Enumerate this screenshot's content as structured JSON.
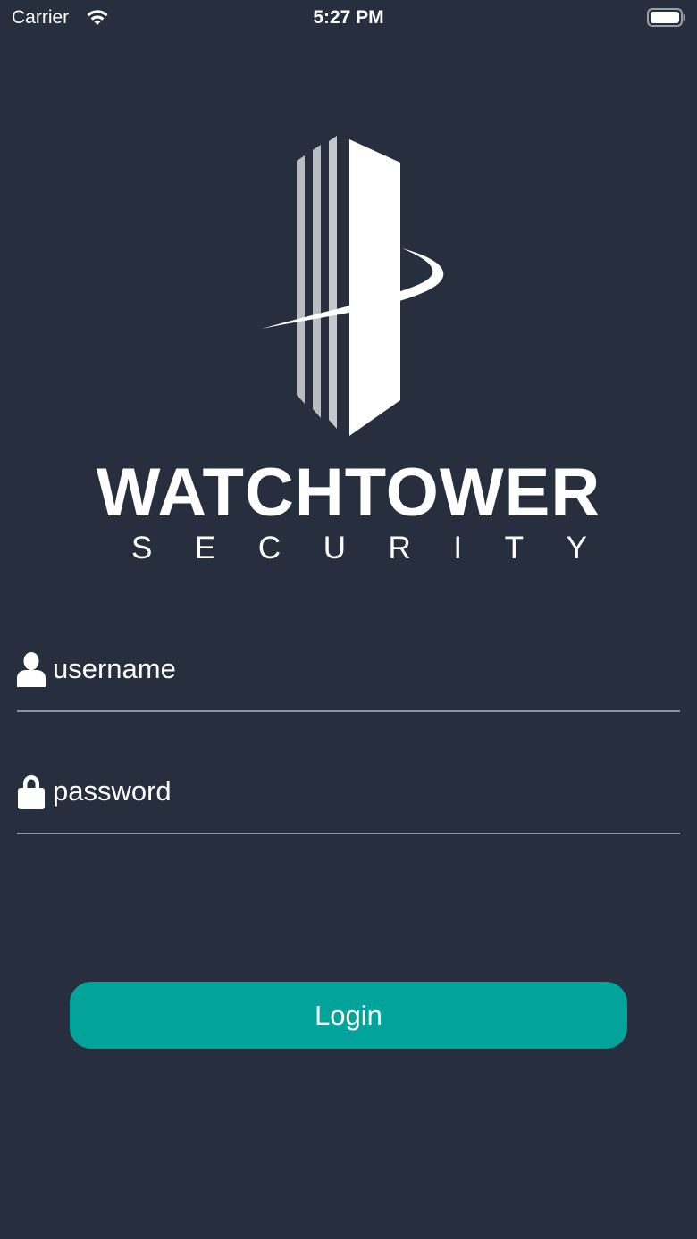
{
  "status_bar": {
    "carrier": "Carrier",
    "time": "5:27 PM",
    "wifi_icon": "wifi-icon",
    "battery_icon": "battery-icon"
  },
  "brand": {
    "logo_icon": "watchtower-logo-icon",
    "name": "WATCHTOWER",
    "subtitle_letters": [
      "S",
      "E",
      "C",
      "U",
      "R",
      "I",
      "T",
      "Y"
    ]
  },
  "login_form": {
    "username": {
      "icon": "user-icon",
      "placeholder": "username",
      "value": ""
    },
    "password": {
      "icon": "lock-icon",
      "placeholder": "password",
      "value": ""
    },
    "login_label": "Login"
  },
  "colors": {
    "background": "#272f3e",
    "accent": "#02a39a",
    "text": "#ffffff",
    "divider": "#8d95a2"
  }
}
